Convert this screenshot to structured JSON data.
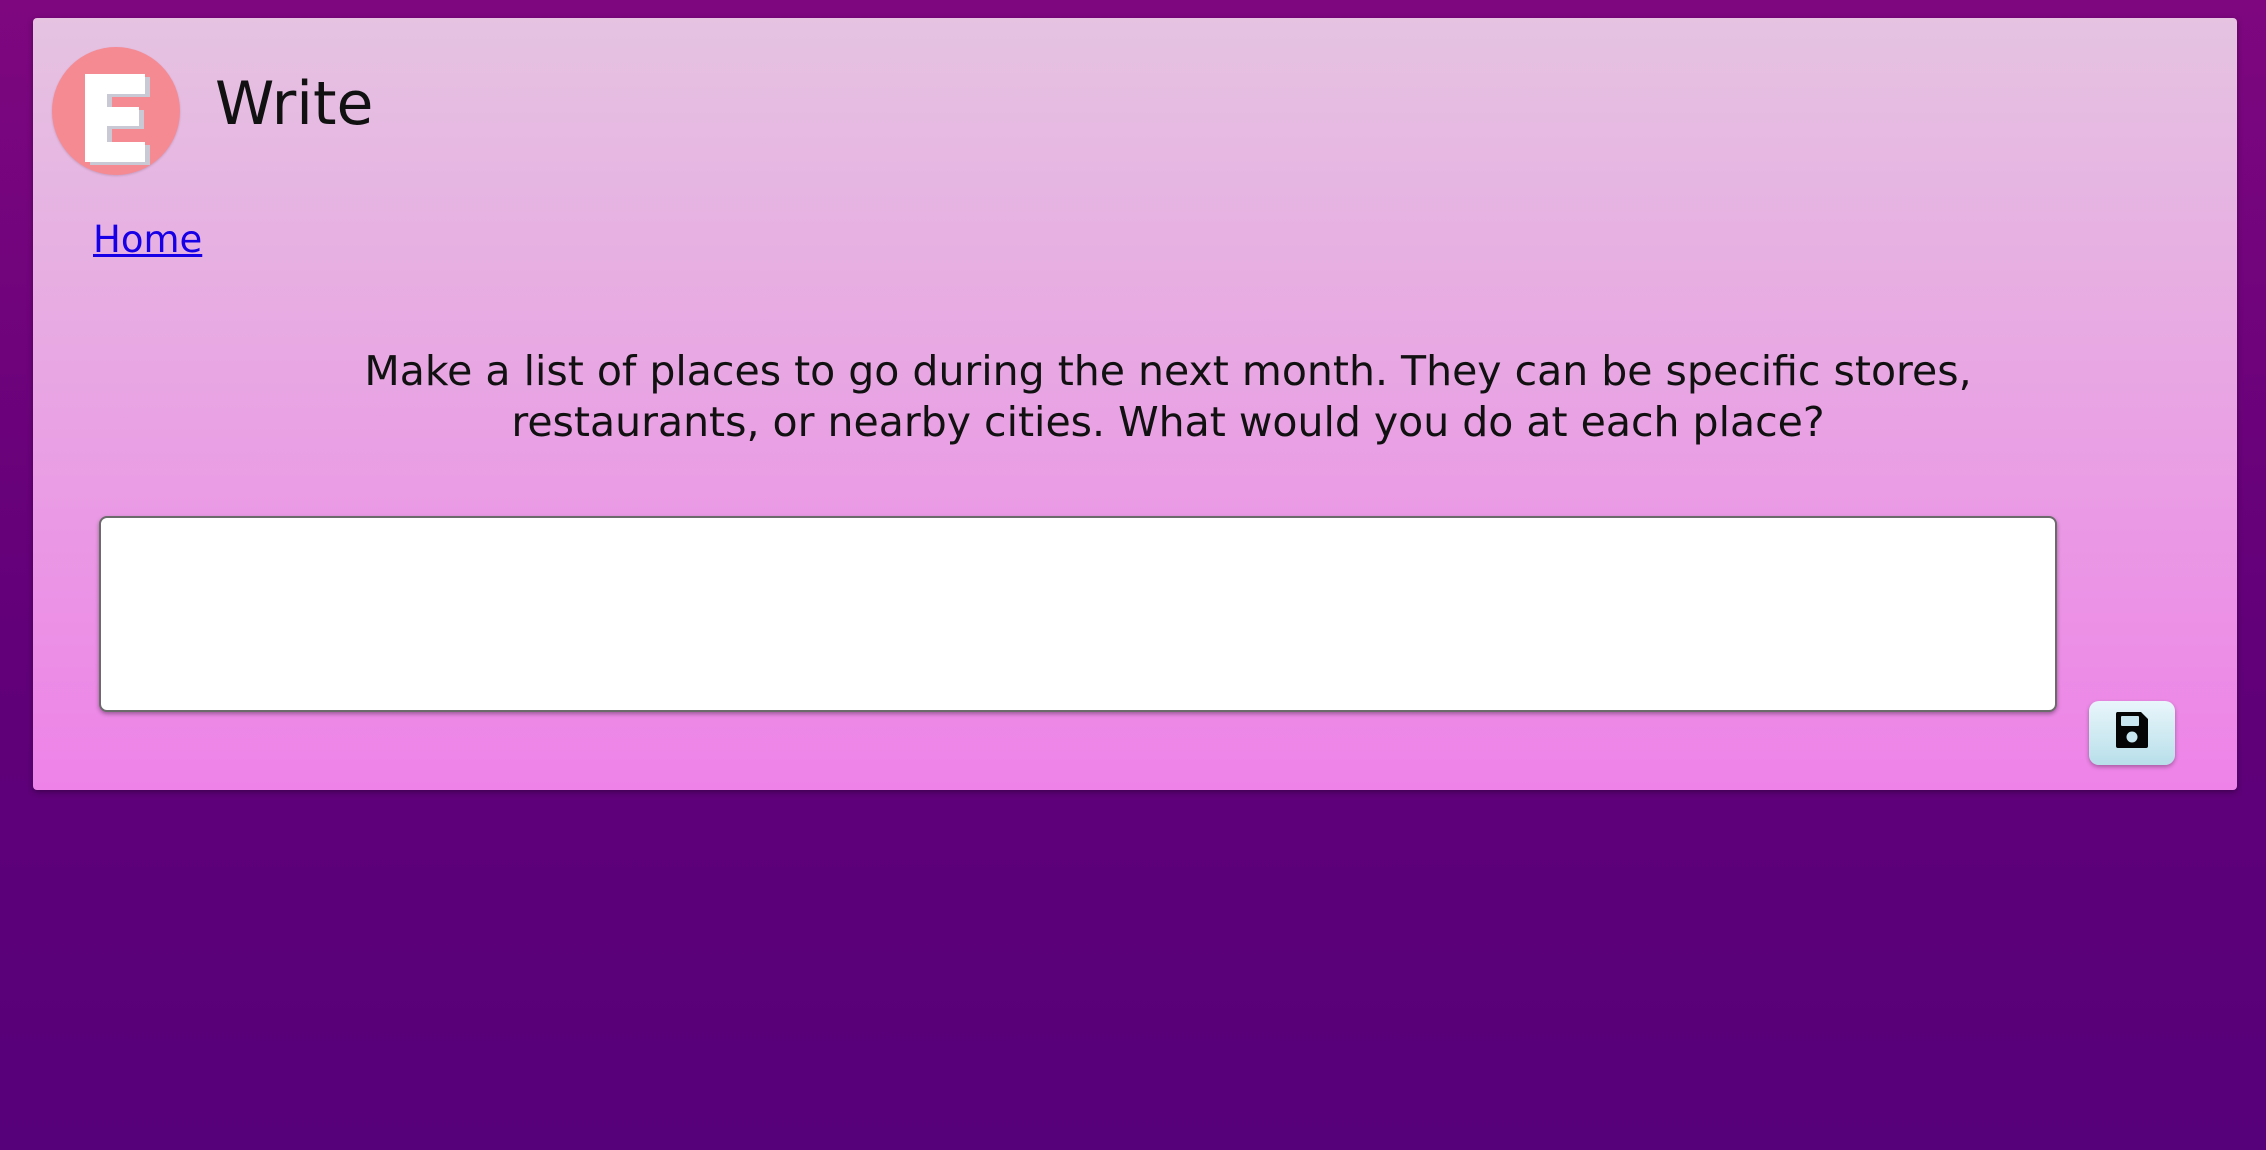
{
  "app": {
    "logo_letter": "E",
    "title": "Write"
  },
  "nav": {
    "home_label": "Home"
  },
  "main": {
    "prompt": "Make a list of places to go during the next month. They can be specific stores, restaurants, or nearby cities. What would you do at each place?",
    "answer_value": "",
    "answer_placeholder": ""
  },
  "actions": {
    "save_icon": "floppy-disk-icon"
  },
  "colors": {
    "background": "#620079",
    "card_top": "#e5c3e1",
    "card_bottom": "#ee82e8",
    "logo_circle": "#f58a93",
    "link": "#1700e6",
    "save_button": "#b8dfea"
  }
}
